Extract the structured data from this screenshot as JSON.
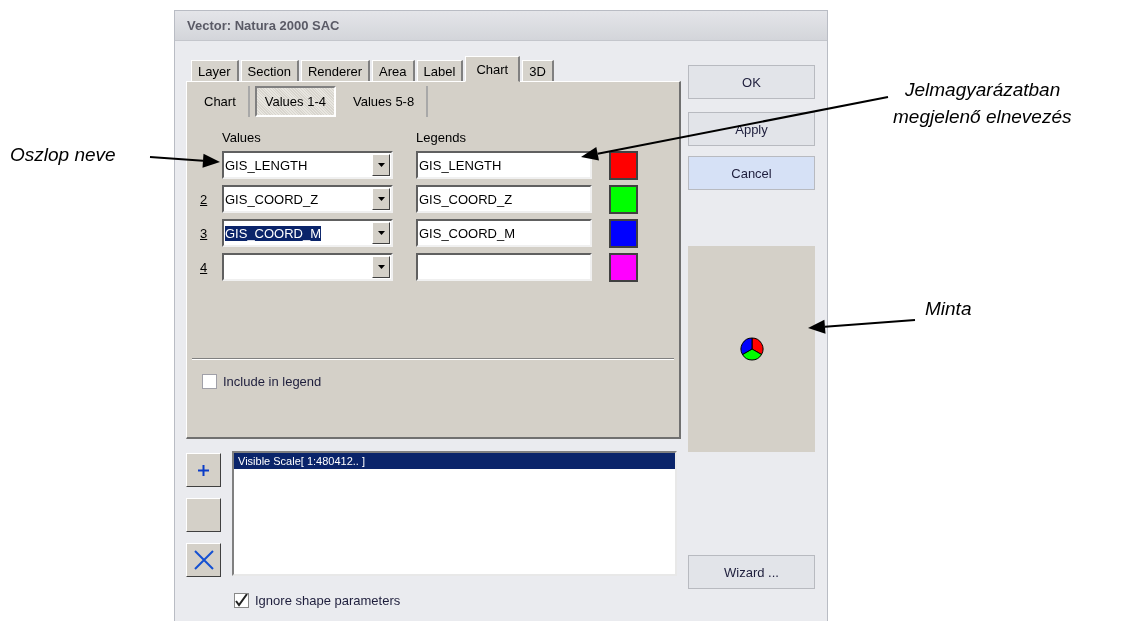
{
  "window": {
    "title": "Vector: Natura 2000 SAC"
  },
  "tabs": [
    {
      "label": "Layer",
      "selected": false
    },
    {
      "label": "Section",
      "selected": false
    },
    {
      "label": "Renderer",
      "selected": false
    },
    {
      "label": "Area",
      "selected": false
    },
    {
      "label": "Label",
      "selected": false
    },
    {
      "label": "Chart",
      "selected": true
    },
    {
      "label": "3D",
      "selected": false
    }
  ],
  "subtabs": [
    {
      "label": "Chart",
      "selected": false
    },
    {
      "label": "Values 1-4",
      "selected": true
    },
    {
      "label": "Values 5-8",
      "selected": false
    }
  ],
  "values_header": "Values",
  "legends_header": "Legends",
  "rows": [
    {
      "value": "GIS_LENGTH",
      "value_selected": false,
      "legend": "GIS_LENGTH",
      "color": "#ff0000"
    },
    {
      "number": "2",
      "value": "GIS_COORD_Z",
      "value_selected": false,
      "legend": "GIS_COORD_Z",
      "color": "#00ff00"
    },
    {
      "number": "3",
      "value": "GIS_COORD_M",
      "value_selected": true,
      "legend": "GIS_COORD_M",
      "color": "#0000ff"
    },
    {
      "number": "4",
      "color": "#ff00ff"
    }
  ],
  "include_in_legend": {
    "label": "Include in legend",
    "checked": false
  },
  "side_buttons": [
    {
      "kind": "add"
    },
    {
      "kind": "blank"
    },
    {
      "kind": "delete"
    }
  ],
  "scale_list": {
    "items": [
      {
        "label": "Visible Scale[ 1:480412.. ]",
        "selected": true
      }
    ]
  },
  "ignore_shape": {
    "label": "Ignore shape parameters",
    "checked": true
  },
  "buttons": [
    {
      "label": "OK",
      "hover": false
    },
    {
      "label": "Apply",
      "hover": false
    },
    {
      "label": "Cancel",
      "hover": true
    }
  ],
  "wizard_button": {
    "label": "Wizard ..."
  },
  "annotations": [
    {
      "text": "Oszlop neve"
    },
    {
      "text": "Jelmagyarázatban megjelenő elnevezés"
    },
    {
      "text": "Minta"
    }
  ]
}
